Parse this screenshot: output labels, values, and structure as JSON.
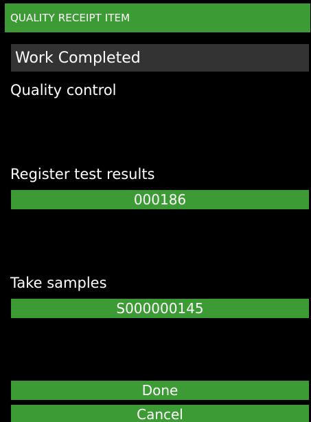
{
  "header": {
    "title": "QUALITY RECEIPT ITEM"
  },
  "status": {
    "value": "Work Completed"
  },
  "sections": {
    "quality_control_label": "Quality control",
    "register_test_results_label": "Register test results",
    "register_test_results_value": "000186",
    "take_samples_label": "Take samples",
    "take_samples_value": "S000000145"
  },
  "actions": {
    "done_label": "Done",
    "cancel_label": "Cancel"
  },
  "colors": {
    "accent_green": "#3d9b35",
    "field_gray": "#333333",
    "background": "#000000",
    "text": "#ffffff"
  }
}
